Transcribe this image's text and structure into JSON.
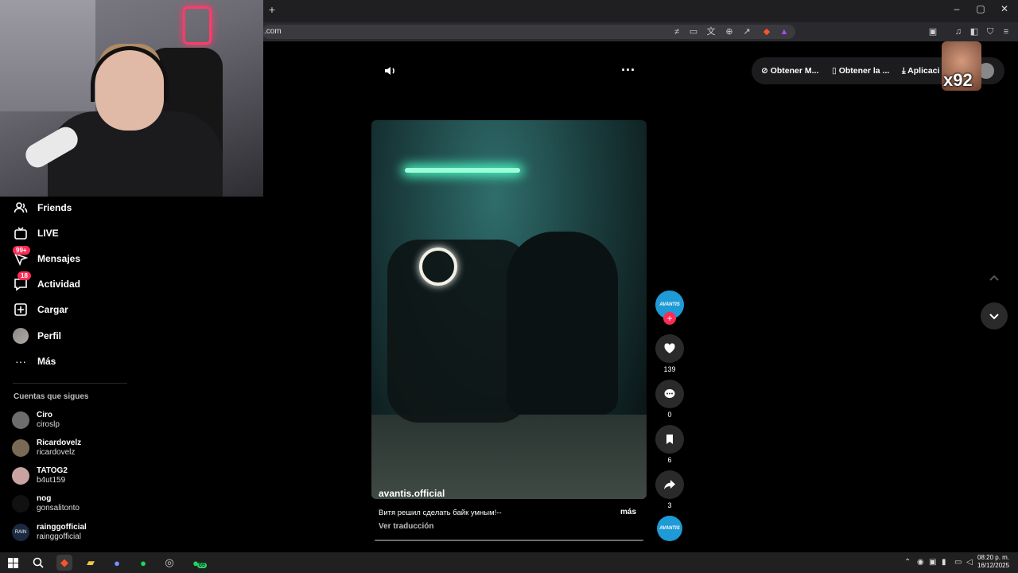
{
  "browser": {
    "new_tab": "+",
    "url": ".com",
    "win_min": "–",
    "win_max": "▢",
    "win_close": "✕"
  },
  "overlay": {
    "multiplier": "x92"
  },
  "nav": {
    "items": [
      {
        "label": "Friends",
        "icon": "friends-icon"
      },
      {
        "label": "LIVE",
        "icon": "live-icon"
      },
      {
        "label": "Mensajes",
        "icon": "messages-icon",
        "badge": "99+"
      },
      {
        "label": "Actividad",
        "icon": "activity-icon",
        "badge": "18"
      },
      {
        "label": "Cargar",
        "icon": "upload-icon"
      },
      {
        "label": "Perfil",
        "icon": "profile-avatar"
      },
      {
        "label": "Más",
        "icon": "more-icon"
      }
    ],
    "following_title": "Cuentas que sigues",
    "following": [
      {
        "name": "Ciro",
        "user": "ciroslp"
      },
      {
        "name": "Ricardovelz",
        "user": "ricardovelz"
      },
      {
        "name": "TATOG2",
        "user": "b4ut159"
      },
      {
        "name": "nog",
        "user": "gonsalitonto"
      },
      {
        "name": "rainggofficial",
        "user": "rainggofficial",
        "avatar_text": "RAIN"
      }
    ]
  },
  "video": {
    "author": "avantis.official",
    "caption": "Витя решил сделать байк умным!--",
    "more": "más",
    "translate": "Ver traducción"
  },
  "actions": {
    "avatar_text": "AVANTIS",
    "likes": "139",
    "comments": "0",
    "saves": "6",
    "shares": "3"
  },
  "header_pill": {
    "item1": "Obtener M...",
    "item2": "Obtener la ...",
    "item3": "Aplicaci"
  },
  "taskbar": {
    "whatsapp_badge": "69",
    "time": "08:20 p. m.",
    "date": "16/12/2025"
  },
  "colors": {
    "accent": "#fe2c55",
    "avantis_blue": "#1e9ad6",
    "background": "#000000"
  }
}
